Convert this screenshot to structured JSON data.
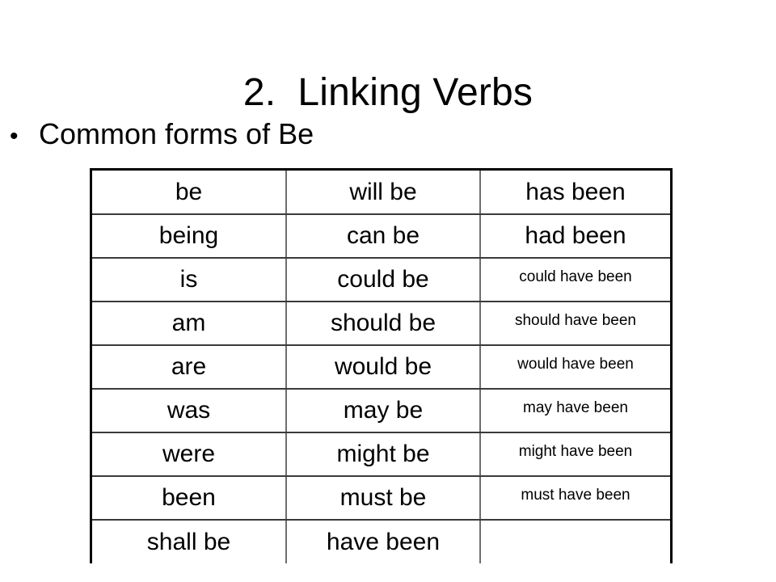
{
  "slide": {
    "title": "2.  Linking Verbs",
    "bullet": {
      "marker": "•",
      "text": "Common forms of Be"
    },
    "background_color": "#ffffff",
    "text_color": "#000000",
    "table_border_color": "#000000",
    "table_grid_color": "#6e6e6e"
  },
  "table": {
    "columns": 3,
    "rows": [
      {
        "c1": "be",
        "c2": "will be",
        "c3": "has been",
        "c3_small": false
      },
      {
        "c1": "being",
        "c2": "can be",
        "c3": "had been",
        "c3_small": false
      },
      {
        "c1": "is",
        "c2": "could be",
        "c3": "could have been",
        "c3_small": true
      },
      {
        "c1": "am",
        "c2": "should be",
        "c3": "should have been",
        "c3_small": true
      },
      {
        "c1": "are",
        "c2": "would be",
        "c3": "would have been",
        "c3_small": true
      },
      {
        "c1": "was",
        "c2": "may be",
        "c3": "may have been",
        "c3_small": true
      },
      {
        "c1": "were",
        "c2": "might be",
        "c3": "might have been",
        "c3_small": true
      },
      {
        "c1": "been",
        "c2": "must be",
        "c3": "must have been",
        "c3_small": true
      },
      {
        "c1": "shall be",
        "c2": "have been",
        "c3": "",
        "c3_small": false
      }
    ]
  }
}
